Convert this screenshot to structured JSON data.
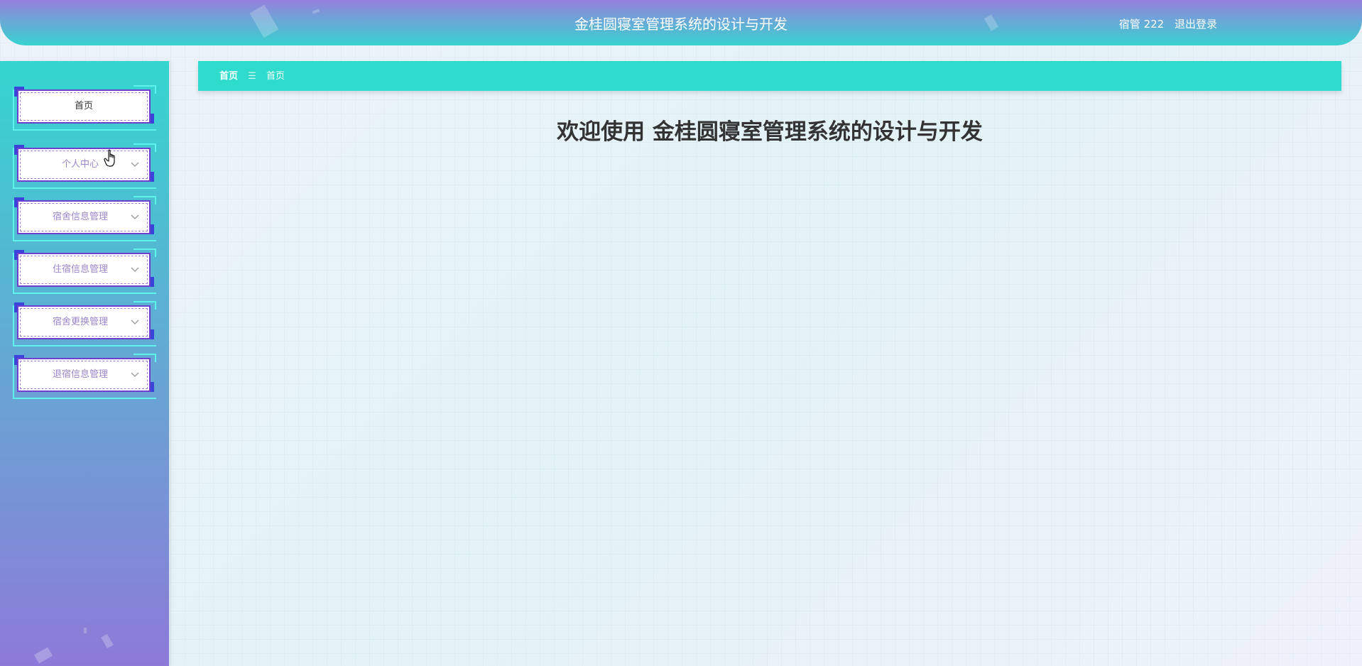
{
  "header": {
    "title": "金桂圆寝室管理系统的设计与开发",
    "user_label": "宿管 222",
    "logout_label": "退出登录"
  },
  "sidebar": {
    "items": [
      {
        "label": "首页",
        "expandable": false,
        "active": true
      },
      {
        "label": "个人中心",
        "expandable": true,
        "active": false
      },
      {
        "label": "宿舍信息管理",
        "expandable": true,
        "active": false
      },
      {
        "label": "住宿信息管理",
        "expandable": true,
        "active": false
      },
      {
        "label": "宿舍更换管理",
        "expandable": true,
        "active": false
      },
      {
        "label": "退宿信息管理",
        "expandable": true,
        "active": false
      }
    ]
  },
  "breadcrumb": {
    "items": [
      "首页",
      "首页"
    ],
    "separator": "☰"
  },
  "main": {
    "welcome": "欢迎使用 金桂圆寝室管理系统的设计与开发"
  },
  "colors": {
    "accent": "#2edbcd",
    "menu_border": "#6d3fd1",
    "corner": "#3b44d8"
  },
  "icons": {
    "menu_expand": "chevron-down-icon",
    "breadcrumb_separator": "menu-icon",
    "pointer": "hand-pointer-icon"
  }
}
